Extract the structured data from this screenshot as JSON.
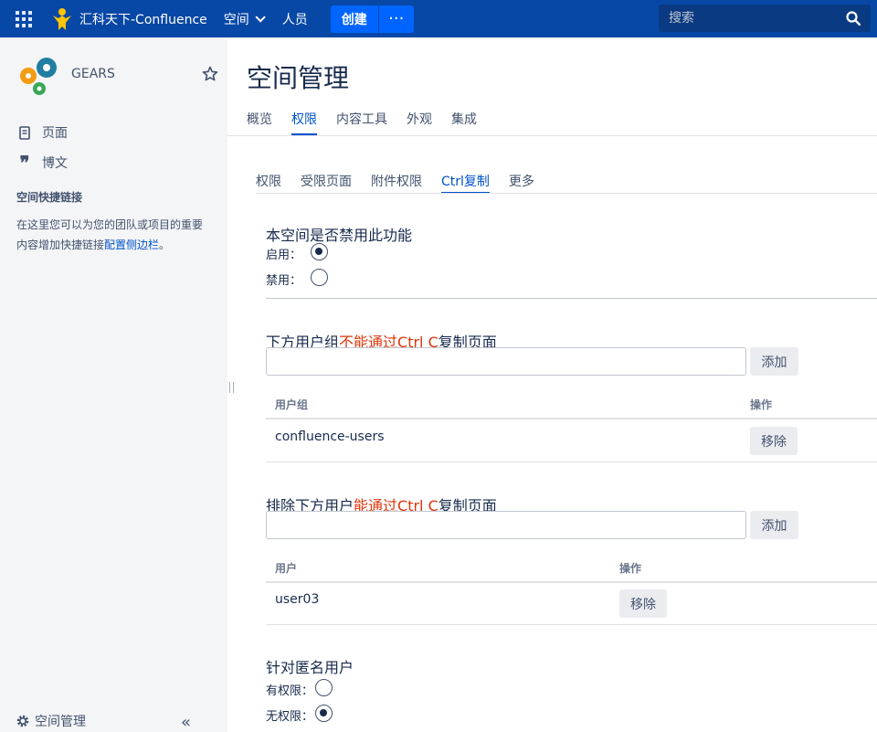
{
  "topnav": {
    "brand": "汇科天下-Confluence",
    "spaces": "空间",
    "people": "人员",
    "create": "创建",
    "more": "···",
    "search_placeholder": "搜索"
  },
  "sidebar": {
    "space_name": "GEARS",
    "links": [
      {
        "label": "页面",
        "icon": "page-icon"
      },
      {
        "label": "博文",
        "icon": "quote-icon"
      }
    ],
    "shortcuts_title": "空间快捷链接",
    "shortcuts_desc": "在这里您可以为您的团队或项目的重要内容增加快捷链接",
    "shortcuts_link": "配置侧边栏",
    "shortcuts_end": "。",
    "bottom_label": "空间管理"
  },
  "main": {
    "title": "空间管理",
    "tabs": [
      "概览",
      "权限",
      "内容工具",
      "外观",
      "集成"
    ],
    "active_tab": "权限",
    "subtabs": [
      "权限",
      "受限页面",
      "附件权限",
      "Ctrl复制",
      "更多"
    ],
    "active_subtab": "Ctrl复制",
    "section1": {
      "title": "本空间是否禁用此功能",
      "options": [
        {
          "label": "启用：",
          "checked": true
        },
        {
          "label": "禁用：",
          "checked": false
        }
      ]
    },
    "section2": {
      "title_pre": "下方用户组",
      "title_red": "不能通过Ctrl C",
      "title_post": "复制页面",
      "add": "添加",
      "col_group": "用户组",
      "col_action": "操作",
      "rows": [
        {
          "name": "confluence-users",
          "action": "移除"
        }
      ]
    },
    "section3": {
      "title_pre": "排除下方用户",
      "title_red": "能通过Ctrl C",
      "title_post": "复制页面",
      "add": "添加",
      "col_user": "用户",
      "col_action": "操作",
      "rows": [
        {
          "name": "user03",
          "action": "移除"
        }
      ]
    },
    "section4": {
      "title": "针对匿名用户",
      "options": [
        {
          "label": "有权限：",
          "checked": false
        },
        {
          "label": "无权限：",
          "checked": true
        }
      ]
    }
  },
  "colors": {
    "nav_bg": "#0747a6",
    "accent": "#0052cc",
    "red_text": "#de350b",
    "sidebar_bg": "#f4f5f7"
  }
}
